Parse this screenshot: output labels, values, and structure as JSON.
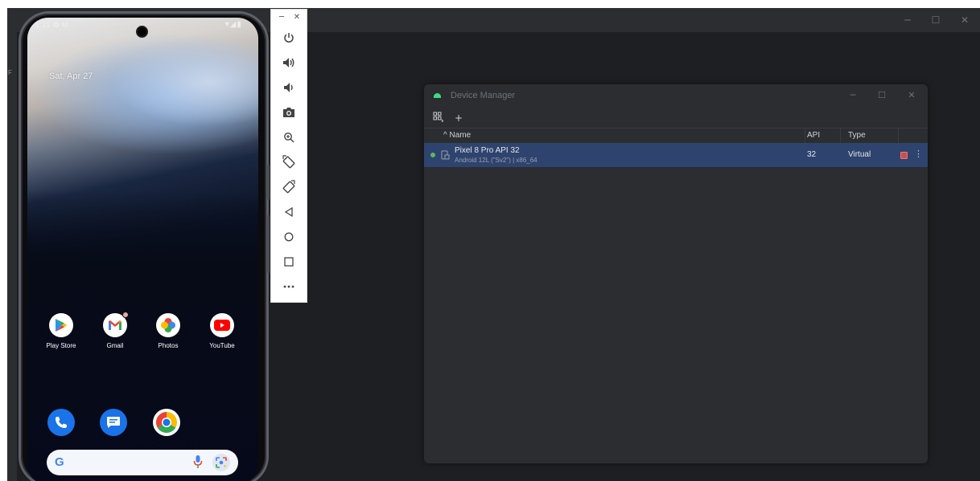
{
  "phone": {
    "status_time": "1:11 ✿ M",
    "status_icons": "▾◢▮",
    "date": "Sat, Apr 27",
    "apps": [
      {
        "label": "Play Store"
      },
      {
        "label": "Gmail"
      },
      {
        "label": "Photos"
      },
      {
        "label": "YouTube"
      }
    ],
    "search_logo": "G"
  },
  "ide": {
    "left_strip_label": "F"
  },
  "device_manager": {
    "title": "Device Manager",
    "add_label": "+",
    "columns": {
      "name": "^ Name",
      "api": "API",
      "type": "Type"
    },
    "devices": [
      {
        "name": "Pixel 8 Pro API 32",
        "subtitle": "Android 12L (\"Sv2\") | x86_64",
        "api": "32",
        "type": "Virtual",
        "running": true
      }
    ]
  },
  "colors": {
    "ide_background": "#1e1f22",
    "panel": "#2b2d30",
    "selected_row": "#2e436e",
    "running_dot": "#5fb85f",
    "stop_button": "#c94f4f"
  }
}
